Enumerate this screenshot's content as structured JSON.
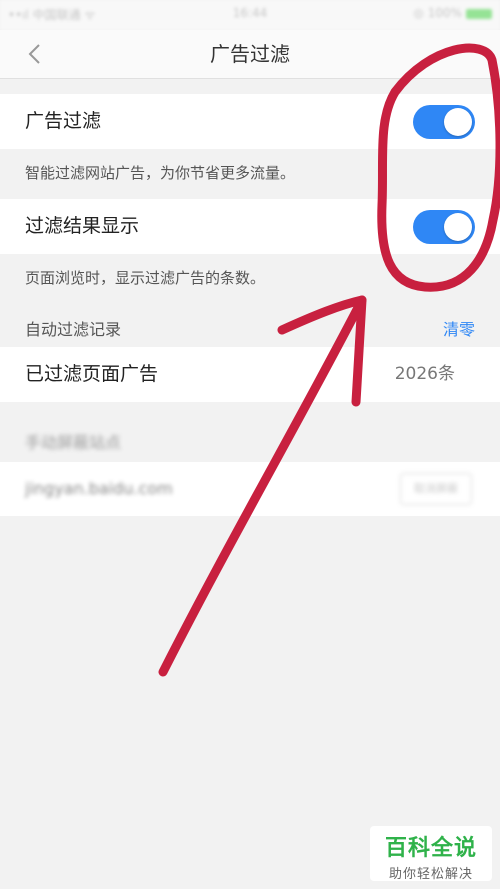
{
  "status_bar": {
    "left": "••ıl 中国联通 ᯤ",
    "time": "16:44",
    "right": "◎ 100%"
  },
  "nav": {
    "title": "广告过滤",
    "back_icon": "chevron-left-icon"
  },
  "ad_filter": {
    "label": "广告过滤",
    "enabled": true,
    "description": "智能过滤网站广告，为你节省更多流量。"
  },
  "filter_result": {
    "label": "过滤结果显示",
    "enabled": true,
    "description": "页面浏览时，显示过滤广告的条数。"
  },
  "auto_record": {
    "section_title": "自动过滤记录",
    "reset_label": "清零",
    "filtered_label": "已过滤页面广告",
    "filtered_count": "2026条"
  },
  "manual_block": {
    "section_title": "手动屏蔽站点",
    "site": "jingyan.baidu.com",
    "action": "取消屏蔽"
  },
  "watermark": {
    "title": "百科全说",
    "subtitle": "助你轻松解决"
  },
  "colors": {
    "accent": "#2f87f5",
    "annotation": "#c8203f",
    "background": "#f2f2f2"
  }
}
